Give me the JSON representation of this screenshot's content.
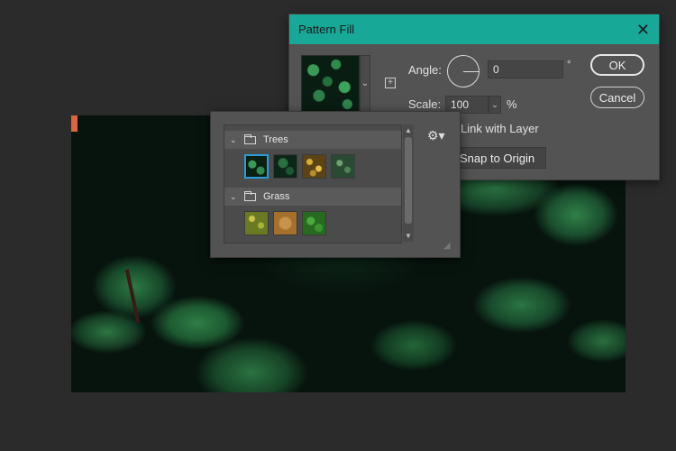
{
  "dialog": {
    "title": "Pattern Fill",
    "close_label": "✕",
    "angle_label": "Angle:",
    "angle_value": "0",
    "angle_unit": "°",
    "scale_label": "Scale:",
    "scale_value": "100",
    "scale_unit": "%",
    "link_label": "Link with Layer",
    "snap_label": "Snap to Origin",
    "ok_label": "OK",
    "cancel_label": "Cancel"
  },
  "picker": {
    "groups": [
      {
        "name": "Trees",
        "tiles": [
          "tree-pattern-1",
          "tree-pattern-2",
          "tree-pattern-3",
          "tree-pattern-4"
        ]
      },
      {
        "name": "Grass",
        "tiles": [
          "grass-pattern-1",
          "grass-pattern-2",
          "grass-pattern-3"
        ]
      }
    ],
    "selected_tile": "tree-pattern-1"
  },
  "icons": {
    "close": "close-icon",
    "gear": "gear-icon",
    "folder": "folder-icon",
    "chevron": "chevron-down-icon",
    "new_preset": "new-preset-icon"
  },
  "colors": {
    "titlebar": "#17a897",
    "selection": "#2b9bd8",
    "panel": "#535353",
    "background": "#2b2b2b"
  }
}
